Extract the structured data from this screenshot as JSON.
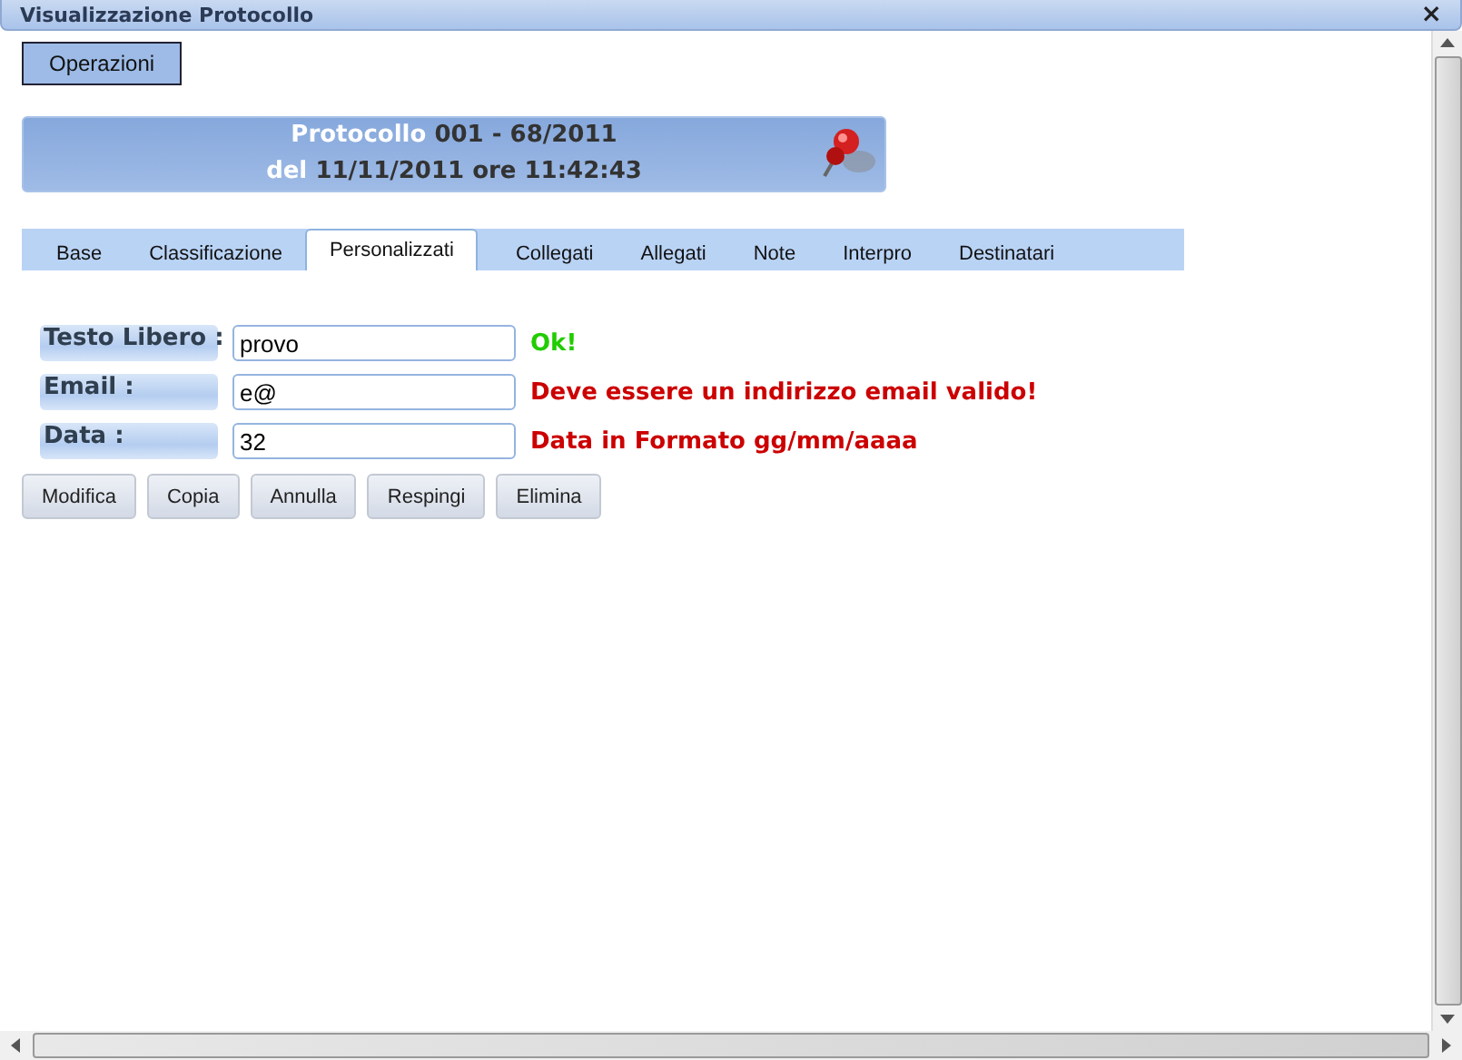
{
  "window": {
    "title": "Visualizzazione Protocollo",
    "close": "×"
  },
  "operations_button": "Operazioni",
  "header": {
    "protocol_label": "Protocollo",
    "protocol_number": "001 - 68/2011",
    "date_label": "del",
    "date_value": "11/11/2011 ore 11:42:43"
  },
  "tabs": [
    {
      "label": "Base",
      "selected": false
    },
    {
      "label": "Classificazione",
      "selected": false
    },
    {
      "label": "Personalizzati",
      "selected": true
    },
    {
      "label": "Collegati",
      "selected": false
    },
    {
      "label": "Allegati",
      "selected": false
    },
    {
      "label": "Note",
      "selected": false
    },
    {
      "label": "Interpro",
      "selected": false
    },
    {
      "label": "Destinatari",
      "selected": false
    }
  ],
  "fields": [
    {
      "label": "Testo Libero :",
      "value": "provo",
      "message": "Ok!",
      "valid": true
    },
    {
      "label": "Email :",
      "value": "e@",
      "message": "Deve essere un indirizzo email valido!",
      "valid": false
    },
    {
      "label": "Data :",
      "value": "32",
      "message": "Data in Formato gg/mm/aaaa",
      "valid": false
    }
  ],
  "buttons": [
    "Modifica",
    "Copia",
    "Annulla",
    "Respingi",
    "Elimina"
  ]
}
